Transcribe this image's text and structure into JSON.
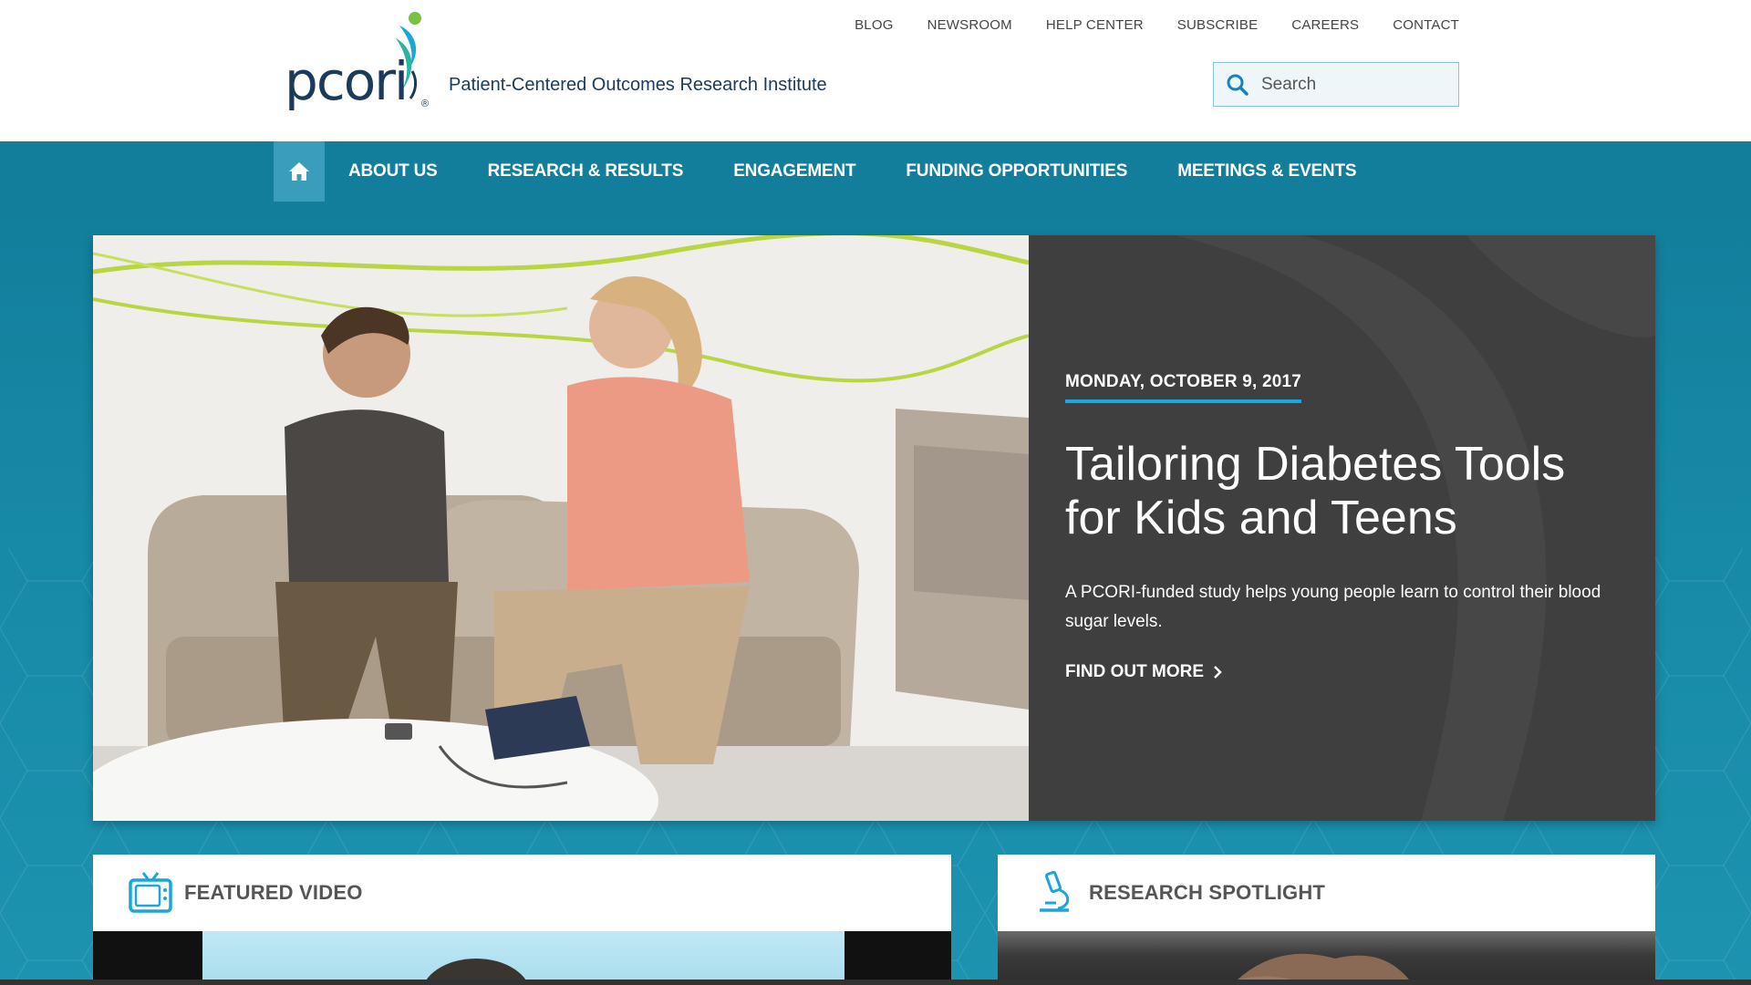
{
  "header": {
    "logo_text": "pcori",
    "logo_reg": "®",
    "tagline": "Patient-Centered Outcomes Research Institute",
    "utility_nav": [
      "BLOG",
      "NEWSROOM",
      "HELP CENTER",
      "SUBSCRIBE",
      "CAREERS",
      "CONTACT"
    ],
    "search_placeholder": "Search"
  },
  "main_nav": {
    "home_icon": "home-icon",
    "items": [
      "ABOUT US",
      "RESEARCH & RESULTS",
      "ENGAGEMENT",
      "FUNDING OPPORTUNITIES",
      "MEETINGS & EVENTS"
    ]
  },
  "hero": {
    "date": "MONDAY, OCTOBER 9, 2017",
    "title": "Tailoring Diabetes Tools for Kids and Teens",
    "description": "A PCORI-funded study helps young people learn to control their blood sugar levels.",
    "cta": "FIND OUT MORE"
  },
  "cards": {
    "video": {
      "title": "FEATURED VIDEO",
      "icon": "tv-icon"
    },
    "research": {
      "title": "RESEARCH SPOTLIGHT",
      "icon": "microscope-icon"
    }
  },
  "colors": {
    "brand_teal": "#127e9c",
    "home_button": "#3a9dbb",
    "accent_blue": "#1aa5dc",
    "hero_panel": "#3f3f3f",
    "navy": "#1b3a5c"
  }
}
